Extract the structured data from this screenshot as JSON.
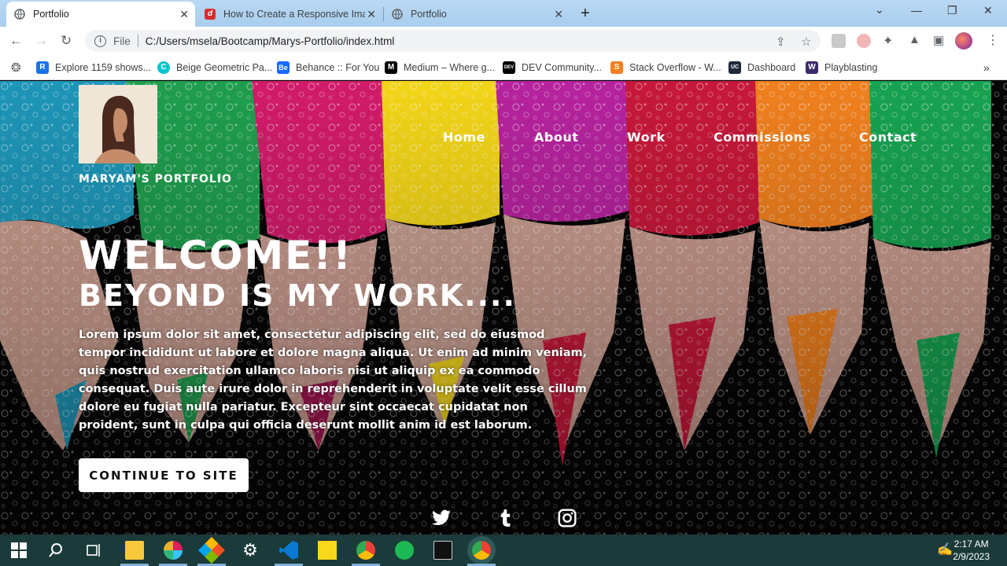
{
  "browser": {
    "tabs": [
      {
        "title": "Portfolio",
        "active": true
      },
      {
        "title": "How to Create a Responsive Ima",
        "active": false
      },
      {
        "title": "Portfolio",
        "active": false
      }
    ],
    "address": {
      "scheme_label": "File",
      "url": "C:/Users/msela/Bootcamp/Marys-Portfolio/index.html"
    },
    "bookmarks": [
      {
        "label": "Explore 1159 shows...",
        "icon": "R",
        "color": "#1a73e8"
      },
      {
        "label": "Beige Geometric Pa...",
        "icon": "C",
        "color": "#00c4cc"
      },
      {
        "label": "Behance :: For You",
        "icon": "Be",
        "color": "#1769ff"
      },
      {
        "label": "Medium – Where g...",
        "icon": "M",
        "color": "#000000"
      },
      {
        "label": "DEV Community...",
        "icon": "DEV",
        "color": "#000000"
      },
      {
        "label": "Stack Overflow - W...",
        "icon": "S",
        "color": "#f48024"
      },
      {
        "label": "Dashboard",
        "icon": "UC",
        "color": "#1e2a38"
      },
      {
        "label": "Playblasting",
        "icon": "W",
        "color": "#3b2a6b"
      }
    ]
  },
  "site": {
    "name": "MARYAM'S PORTFOLIO",
    "nav": [
      "Home",
      "About",
      "Work",
      "Commissions",
      "Contact"
    ],
    "hero_title": "WELCOME!!",
    "hero_subtitle": "BEYOND IS MY WORK....",
    "hero_text": "Lorem ipsum dolor sit amet, consectetur adipiscing elit, sed do eiusmod tempor incididunt ut labore et dolore magna aliqua. Ut enim ad minim veniam, quis nostrud exercitation ullamco laboris nisi ut aliquip ex ea commodo consequat. Duis aute irure dolor in reprehenderit in voluptate velit esse cillum dolore eu fugiat nulla pariatur. Excepteur sint occaecat cupidatat non proident, sunt in culpa qui officia deserunt mollit anim id est laborum.",
    "cta_label": "CONTINUE TO SITE",
    "social": [
      "twitter-icon",
      "tumblr-icon",
      "instagram-icon"
    ]
  },
  "taskbar": {
    "time": "2:17 AM",
    "date": "2/9/2023",
    "apps": [
      "start-icon",
      "search-icon",
      "task-view-icon",
      "file-explorer-icon",
      "slack-icon",
      "git-icon",
      "settings-icon",
      "vscode-icon",
      "sticky-notes-icon",
      "chrome-icon",
      "spotify-icon",
      "terminal-icon",
      "chrome-dev-icon"
    ]
  },
  "colors": {
    "accent": "#ffffff",
    "taskbar": "#1b3a3a",
    "tabstrip": "#b9d9f3"
  }
}
